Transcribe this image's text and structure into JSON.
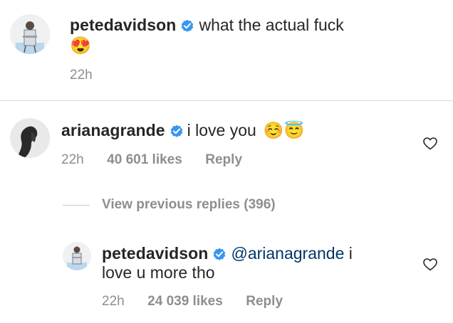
{
  "comments": [
    {
      "username": "petedavidson",
      "text": "what the actual fuck",
      "emoji": "😍",
      "time": "22h"
    },
    {
      "username": "arianagrande",
      "text": "i love you",
      "emoji": "☺️😇",
      "time": "22h",
      "likes": "40 601 likes",
      "reply_label": "Reply"
    }
  ],
  "view_replies_label": "View previous replies (396)",
  "reply": {
    "username": "petedavidson",
    "mention": "@arianagrande",
    "text_after_mention": " i",
    "text_line2": "love u more tho",
    "time": "22h",
    "likes": "24 039 likes",
    "reply_label": "Reply"
  },
  "colors": {
    "text": "#262626",
    "meta": "#8e8e8e",
    "mention": "#003569",
    "verified": "#3897f0",
    "divider": "#dbdbdb"
  }
}
